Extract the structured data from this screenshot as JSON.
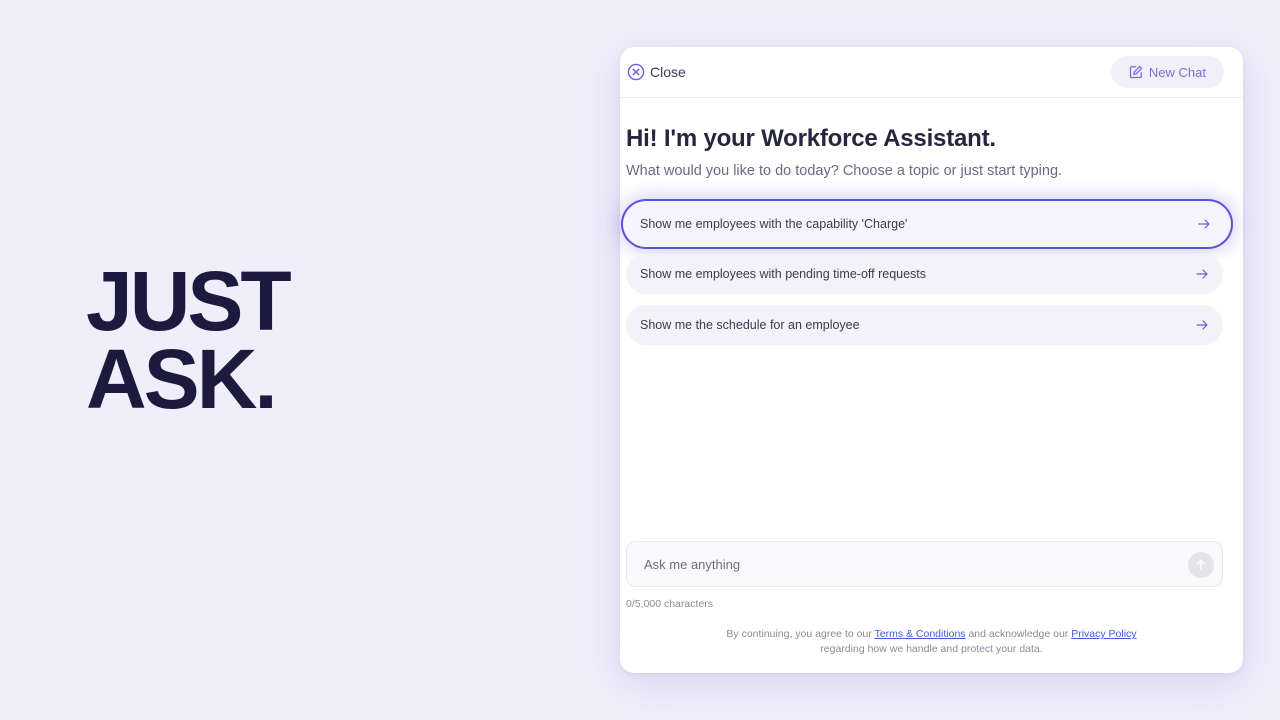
{
  "hero": {
    "line1": "JUST",
    "line2": "ASK."
  },
  "header": {
    "close_label": "Close",
    "new_chat_label": "New Chat"
  },
  "greeting": {
    "title": "Hi! I'm your Workforce Assistant.",
    "subtitle": "What would you like to do today? Choose a topic or just start typing."
  },
  "suggestions": [
    {
      "label": "Show me employees with the capability 'Charge'",
      "active": true
    },
    {
      "label": "Show me employees with pending time-off requests",
      "active": false
    },
    {
      "label": "Show me the schedule for an employee",
      "active": false
    }
  ],
  "input": {
    "placeholder": "Ask me anything",
    "value": "",
    "char_count": "0/5,000 characters"
  },
  "disclaimer": {
    "prefix": "By continuing, you agree to our ",
    "terms_link": "Terms & Conditions",
    "middle": " and acknowledge our ",
    "privacy_link": "Privacy Policy",
    "suffix": "regarding how we handle and protect your data."
  },
  "icons": {
    "close": "close-circle-icon",
    "new_chat": "edit-icon",
    "suggestion_arrow": "arrow-right-icon",
    "send": "arrow-up-icon"
  },
  "colors": {
    "accent": "#7b6ee0",
    "active_border": "#5b55d6",
    "link": "#3f5fd6",
    "hero_text": "#1c1b3d",
    "background": "#f0eefa"
  }
}
